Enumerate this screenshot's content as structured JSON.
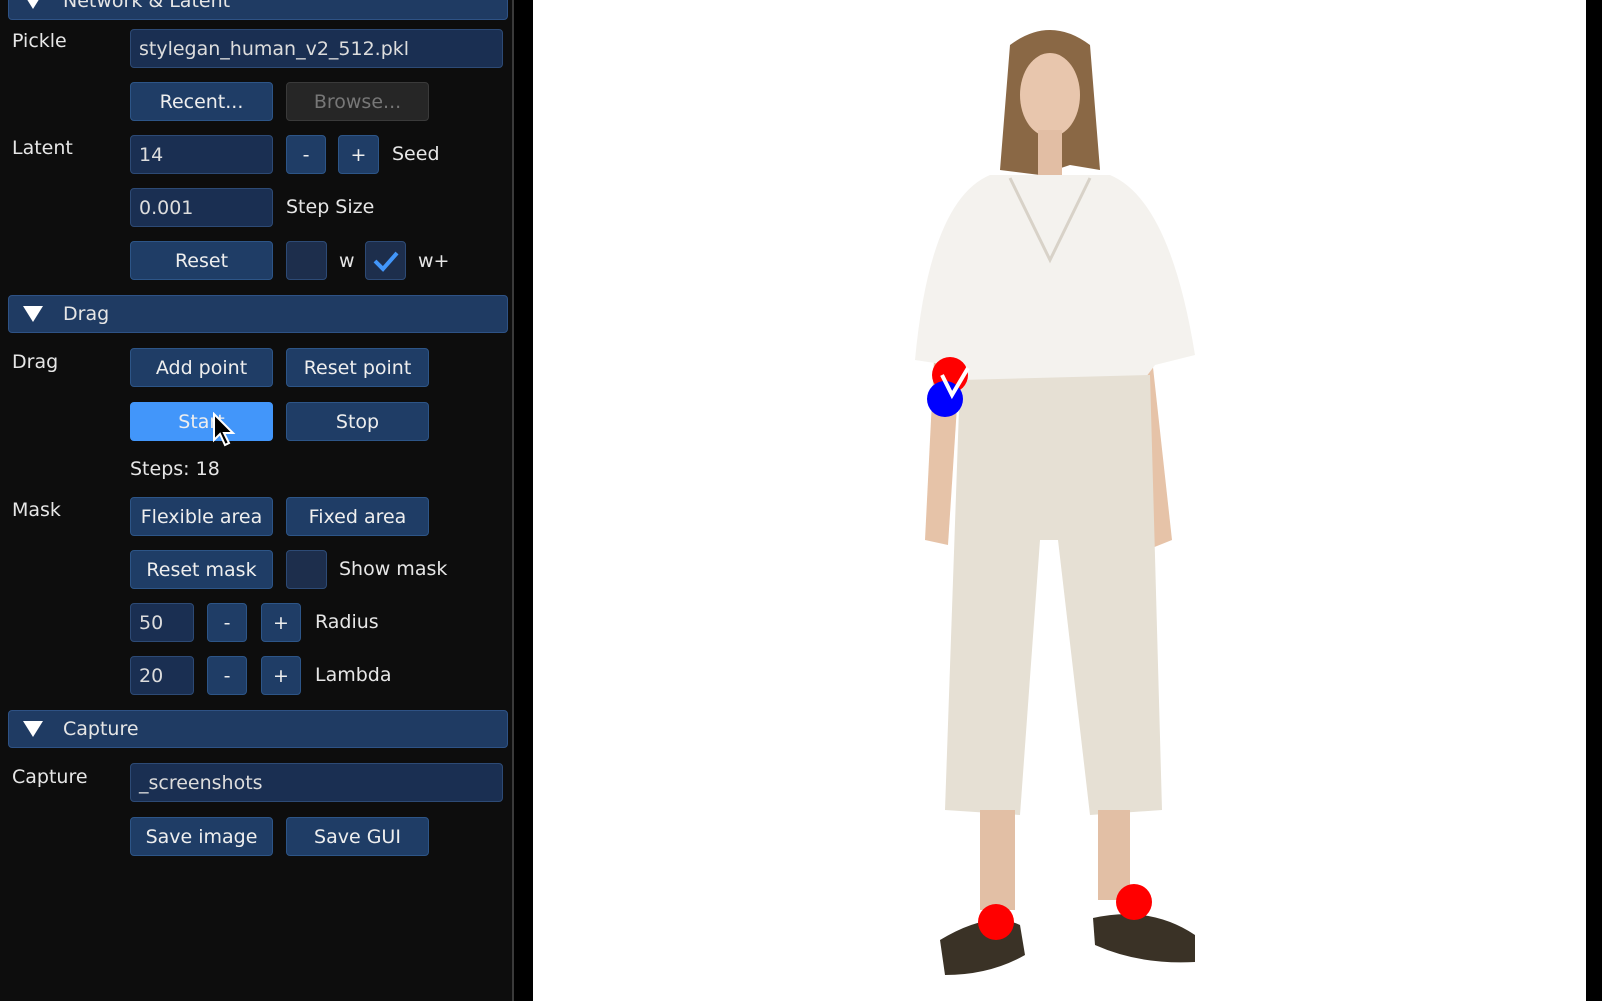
{
  "panel": {
    "network_section": {
      "title": "Network & Latent"
    },
    "pickle": {
      "label": "Pickle",
      "value": "stylegan_human_v2_512.pkl",
      "recent": "Recent...",
      "browse": "Browse..."
    },
    "latent": {
      "label": "Latent",
      "seed_value": "14",
      "minus": "-",
      "plus": "+",
      "seed_label": "Seed",
      "step_value": "0.001",
      "step_label": "Step Size",
      "reset": "Reset",
      "w_label": "w",
      "w_checked": false,
      "wplus_label": "w+",
      "wplus_checked": true
    },
    "drag_section": {
      "title": "Drag"
    },
    "drag": {
      "label": "Drag",
      "add_point": "Add point",
      "reset_point": "Reset point",
      "start": "Start",
      "stop": "Stop",
      "steps": "Steps: 18"
    },
    "mask": {
      "label": "Mask",
      "flexible": "Flexible area",
      "fixed": "Fixed area",
      "reset_mask": "Reset mask",
      "show_mask": "Show mask",
      "show_mask_checked": false,
      "radius_value": "50",
      "radius_label": "Radius",
      "lambda_value": "20",
      "lambda_label": "Lambda",
      "minus": "-",
      "plus": "+"
    },
    "capture_section": {
      "title": "Capture"
    },
    "capture": {
      "label": "Capture",
      "value": "_screenshots",
      "save_image": "Save image",
      "save_gui": "Save GUI"
    }
  },
  "colors": {
    "accent": "#4296fa",
    "header": "#1f3b63",
    "handle_point": "#ff0000",
    "target_point": "#0000ff"
  }
}
